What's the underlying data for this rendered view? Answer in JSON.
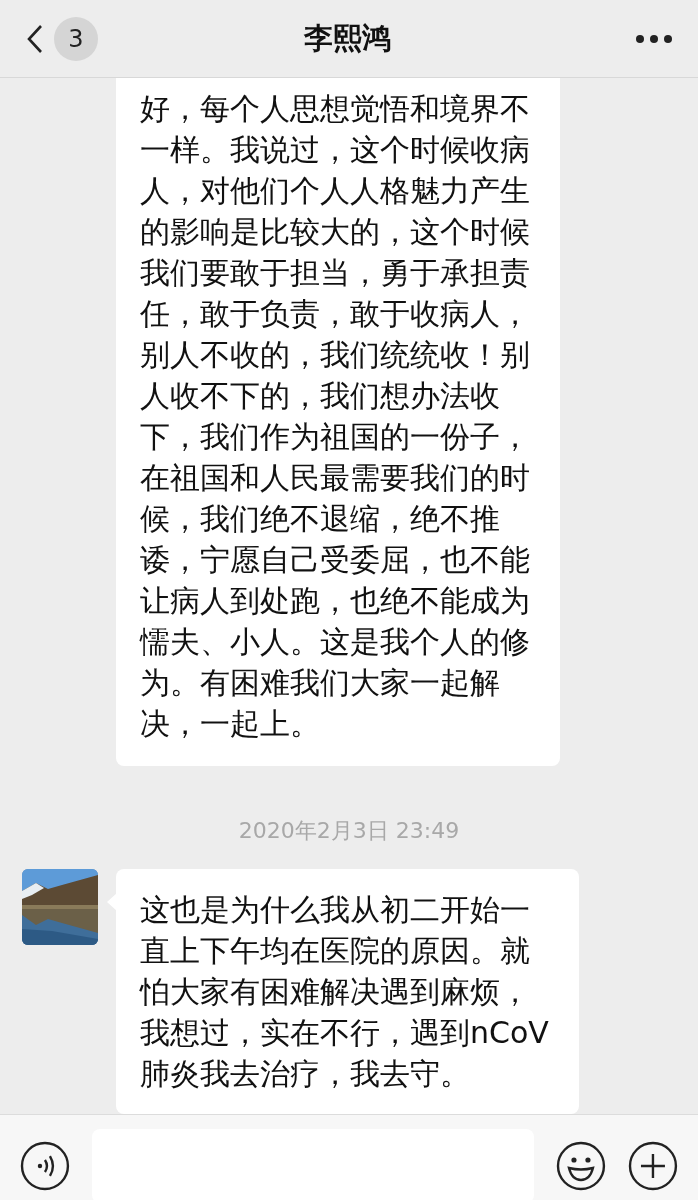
{
  "header": {
    "back_count": "3",
    "title": "李熙鸿"
  },
  "messages": [
    {
      "kind": "bubble",
      "lines": [
        "好，每个人思想觉悟和境界不",
        "一样。我说过，这个时候收病",
        "人，对他们个人人格魅力产生",
        "的影响是比较大的，这个时候",
        "我们要敢于担当，勇于承担责",
        "任，敢于负责，敢于收病人，",
        "别人不收的，我们统统收！别",
        "人收不下的，我们想办法收",
        "下，我们作为祖国的一份子，",
        "在祖国和人民最需要我们的时",
        "候，我们绝不退缩，绝不推",
        "诿，宁愿自己受委屈，也不能",
        "让病人到处跑，也绝不能成为",
        "懦夫、小人。这是我个人的修",
        "为。有困难我们大家一起解",
        "决，一起上。"
      ]
    },
    {
      "kind": "time",
      "text": "2020年2月3日 23:49"
    },
    {
      "kind": "bubble",
      "lines": [
        "这也是为什么我从初二开始一",
        "直上下午均在医院的原因。就",
        "怕大家有困难解决遇到麻烦，",
        "我想过，实在不行，遇到nCoV",
        "肺炎我去治疗，我去守。"
      ]
    }
  ]
}
